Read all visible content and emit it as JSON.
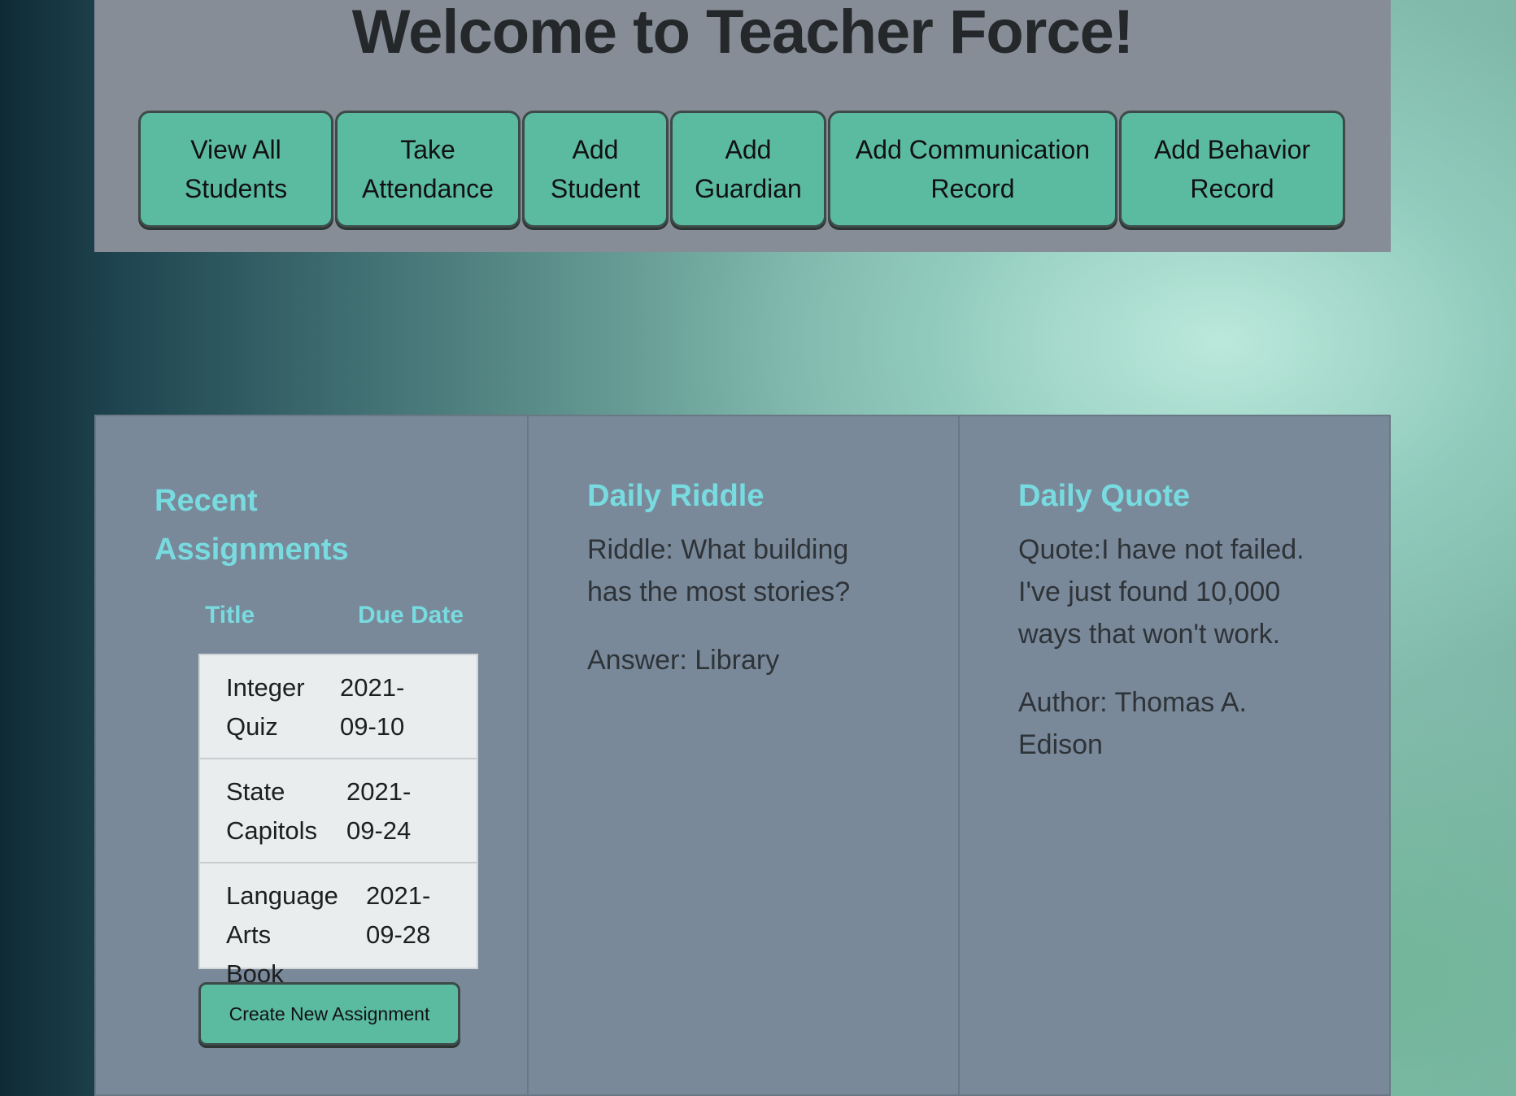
{
  "header": {
    "title": "Welcome to Teacher Force!",
    "nav": [
      {
        "line1": "View All",
        "line2": "Students"
      },
      {
        "line1": "Take",
        "line2": "Attendance"
      },
      {
        "line1": "Add",
        "line2": "Student"
      },
      {
        "line1": "Add",
        "line2": "Guardian"
      },
      {
        "line1": "Add Communication",
        "line2": "Record"
      },
      {
        "line1": "Add Behavior",
        "line2": "Record"
      }
    ]
  },
  "assignments": {
    "title_line1": "Recent",
    "title_line2": "Assignments",
    "col_title": "Title",
    "col_due": "Due Date",
    "rows": [
      {
        "title1": "Integer",
        "title2": "Quiz",
        "date1": "2021-",
        "date2": "09-10"
      },
      {
        "title1": "State",
        "title2": "Capitols",
        "date1": "2021-",
        "date2": "09-24"
      },
      {
        "title1": "Language",
        "title2": "Arts Book",
        "date1": "2021-",
        "date2": "09-28"
      }
    ],
    "create_label": "Create New Assignment"
  },
  "riddle": {
    "title": "Daily Riddle",
    "line1": "Riddle: What building",
    "line2": "has the most stories?",
    "answer": "Answer: Library"
  },
  "quote": {
    "title": "Daily Quote",
    "line1": "Quote:I have not failed.",
    "line2": "I've just found 10,000",
    "line3": "ways that won't work.",
    "author1": "Author: Thomas A.",
    "author2": "Edison"
  },
  "colors": {
    "button": "#5bbba1",
    "accent_text": "#78dbe0",
    "panel": "#79899a"
  }
}
